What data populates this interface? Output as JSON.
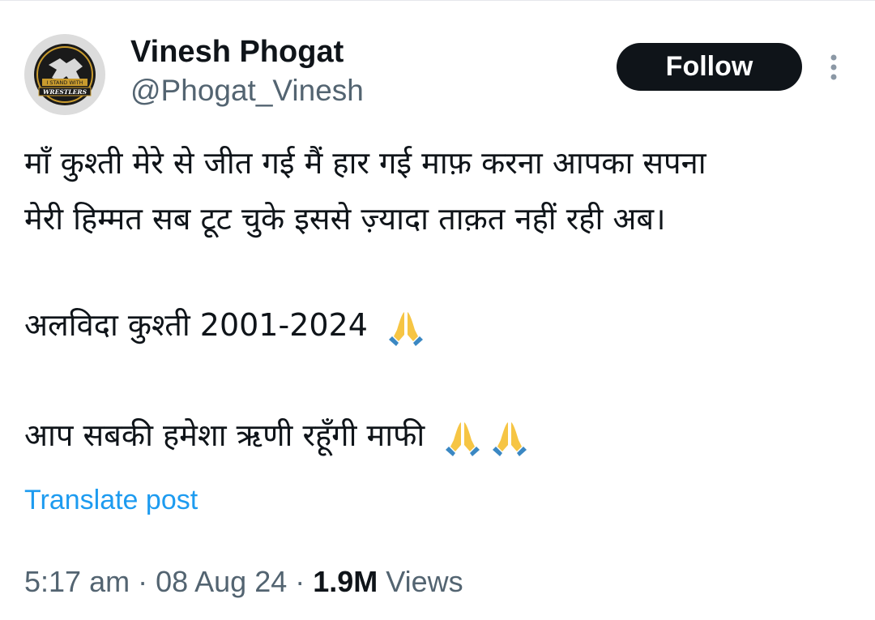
{
  "user": {
    "display_name": "Vinesh Phogat",
    "handle": "@Phogat_Vinesh",
    "avatar_text_top": "I STAND WITH",
    "avatar_text_bottom": "WRESTLERS"
  },
  "actions": {
    "follow_label": "Follow",
    "more_icon": "vertical-dots-icon"
  },
  "tweet": {
    "lines": [
      "माँ कुश्ती मेरे से जीत गई मैं हार गई माफ़ करना आपका सपना",
      "मेरी हिम्मत सब टूट चुके इससे ज़्यादा ताक़त नहीं रही अब।",
      "अलविदा कुश्ती 2001-2024",
      "आप सबकी हमेशा ऋणी रहूँगी माफी"
    ],
    "emoji_icon": "folded-hands-emoji"
  },
  "translate_label": "Translate post",
  "meta": {
    "time": "5:17 am",
    "separator": " · ",
    "date": "08 Aug 24",
    "views_count": "1.9M",
    "views_label": " Views"
  },
  "colors": {
    "text": "#0f1419",
    "secondary": "#536471",
    "link": "#1d9bf0",
    "follow_bg": "#0f1419",
    "emoji_yellow": "#f6c544",
    "emoji_blue": "#3b88c3"
  }
}
